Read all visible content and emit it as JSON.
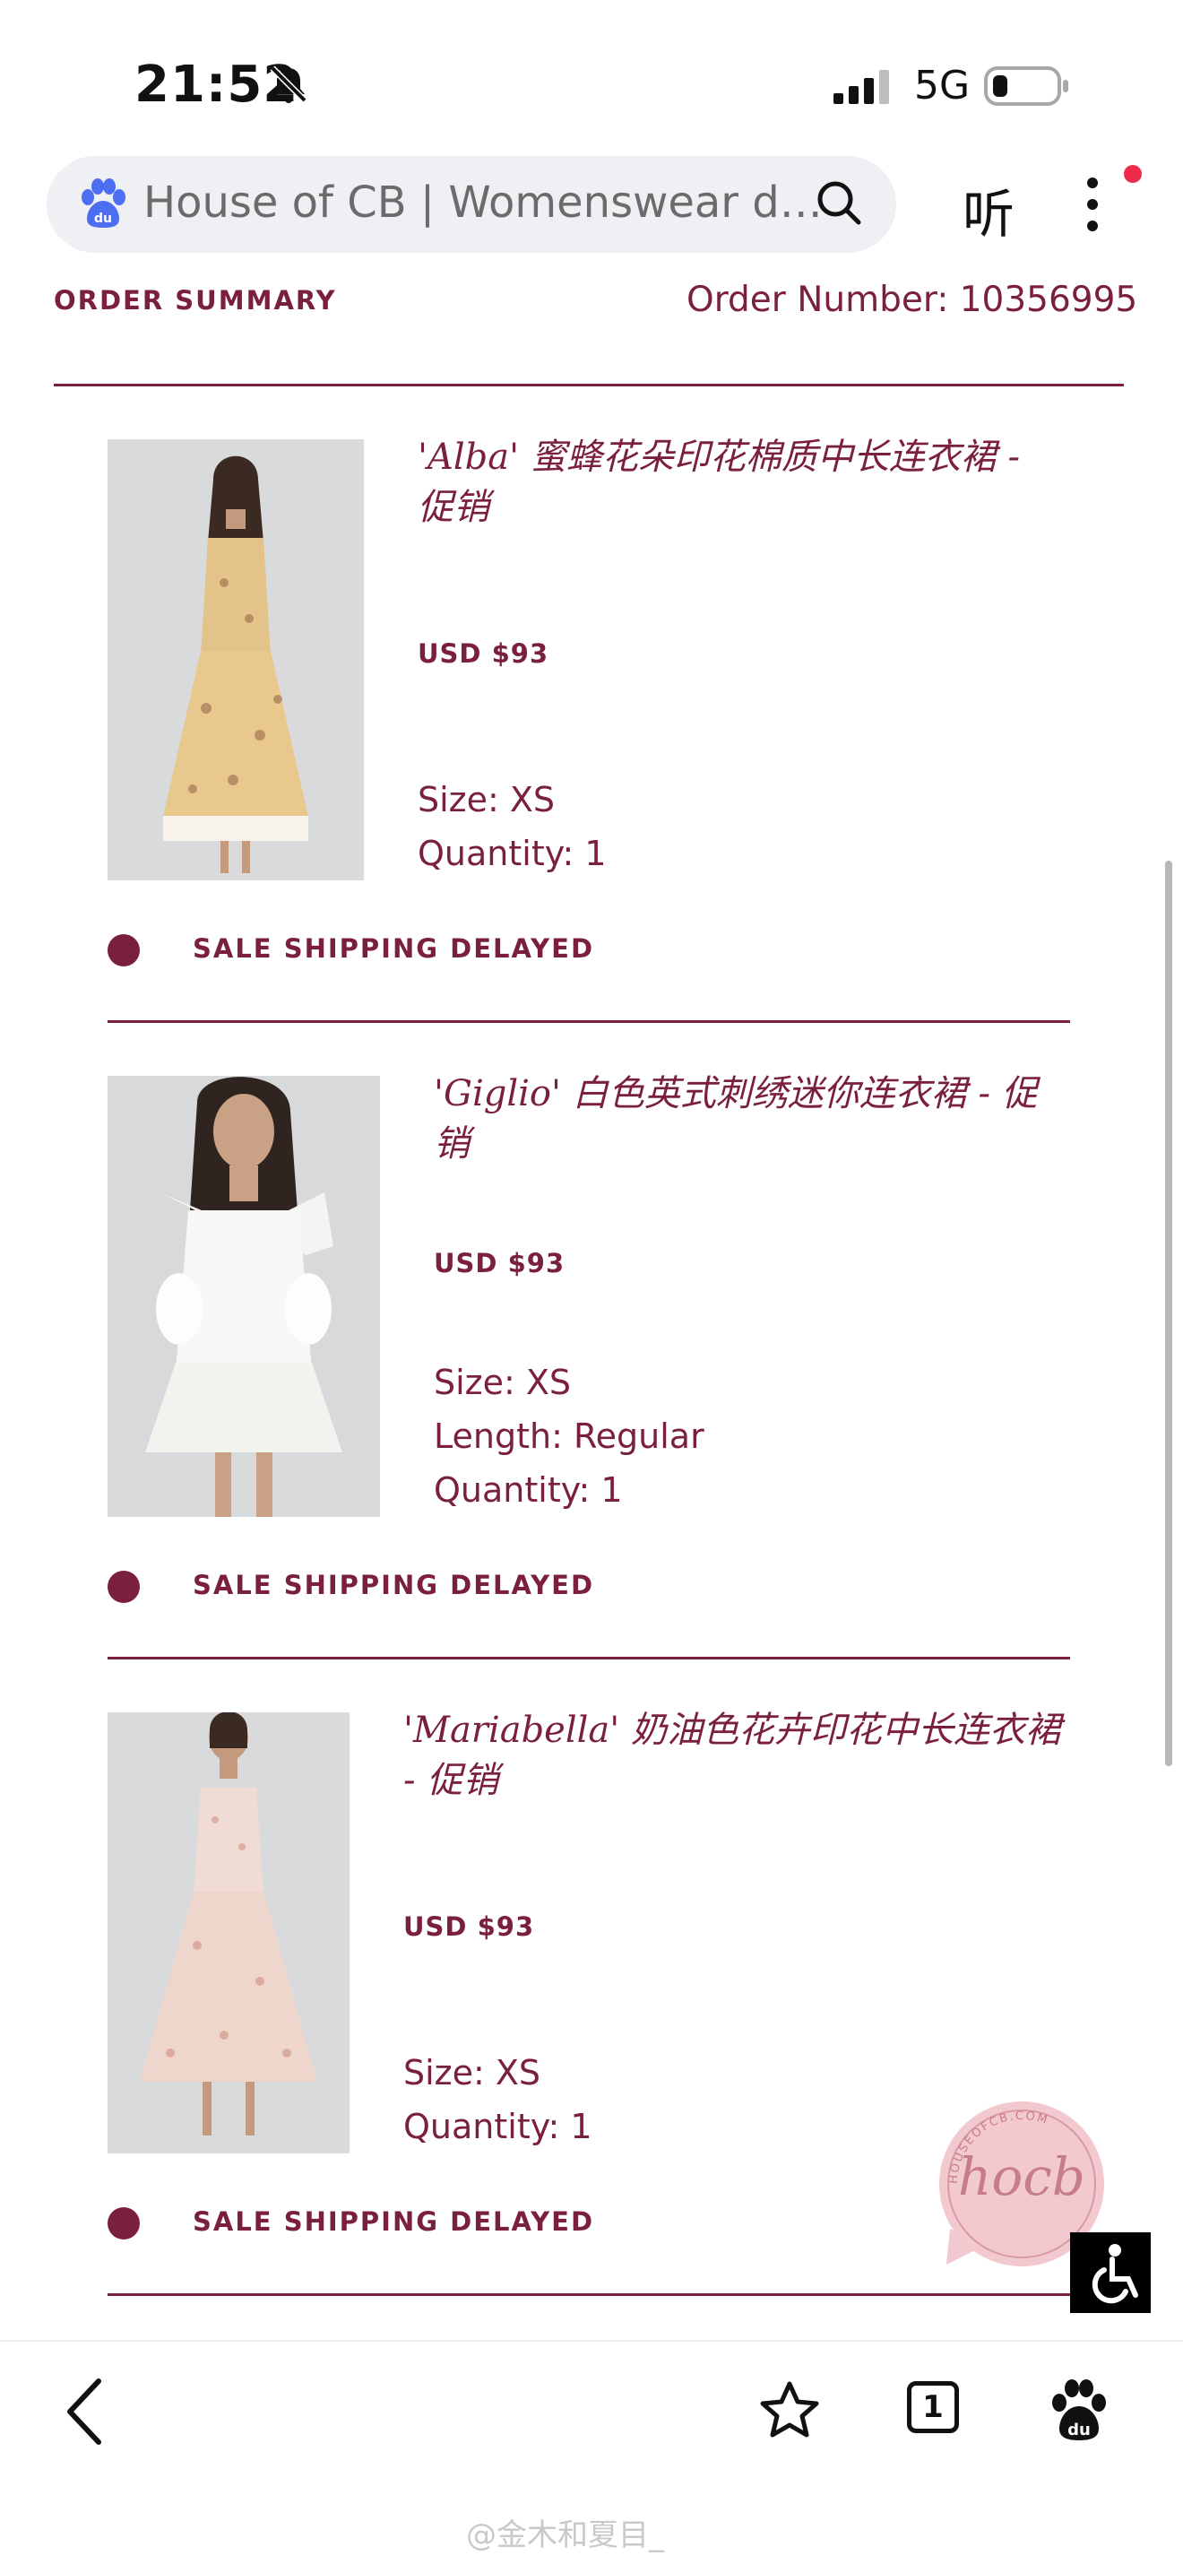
{
  "status_bar": {
    "time": "21:52",
    "network": "5G"
  },
  "browser": {
    "url_title": "House of CB | Womenswear d…",
    "listen_label": "听"
  },
  "header": {
    "title": "ORDER SUMMARY",
    "order_number": "Order Number: 10356995"
  },
  "items": [
    {
      "name_line1": "'Alba' 蜜蜂花朵印花棉质中长连衣裙 -",
      "name_line2": "促销",
      "price": "USD $93",
      "attributes": [
        "Size: XS",
        "Quantity: 1"
      ],
      "status": "SALE SHIPPING DELAYED"
    },
    {
      "name_line1": "'Giglio' 白色英式刺绣迷你连衣裙 - 促",
      "name_line2": "销",
      "price": "USD $93",
      "attributes": [
        "Size: XS",
        "Length: Regular",
        "Quantity: 1"
      ],
      "status": "SALE SHIPPING DELAYED"
    },
    {
      "name_line1": "'Mariabella' 奶油色花卉印花中长连衣裙",
      "name_line2": "- 促销",
      "price": "USD $93",
      "attributes": [
        "Size: XS",
        "Quantity: 1"
      ],
      "status": "SALE SHIPPING DELAYED"
    }
  ],
  "chat_badge": {
    "seal_text": "HOUSEOFCB.COM",
    "logo_text": "hocb"
  },
  "tab_count": "1",
  "watermark": "@金木和夏目_",
  "colors": {
    "brand": "#7a1f3d",
    "url_bar": "#eef0f3",
    "notify_dot": "#ef2b4b"
  },
  "icons": [
    "bell-off-icon",
    "signal-icon",
    "battery-icon",
    "baidu-paw-icon",
    "search-icon",
    "more-icon",
    "back-icon",
    "star-icon",
    "tabs-icon",
    "baidu-home-icon",
    "accessibility-icon"
  ]
}
